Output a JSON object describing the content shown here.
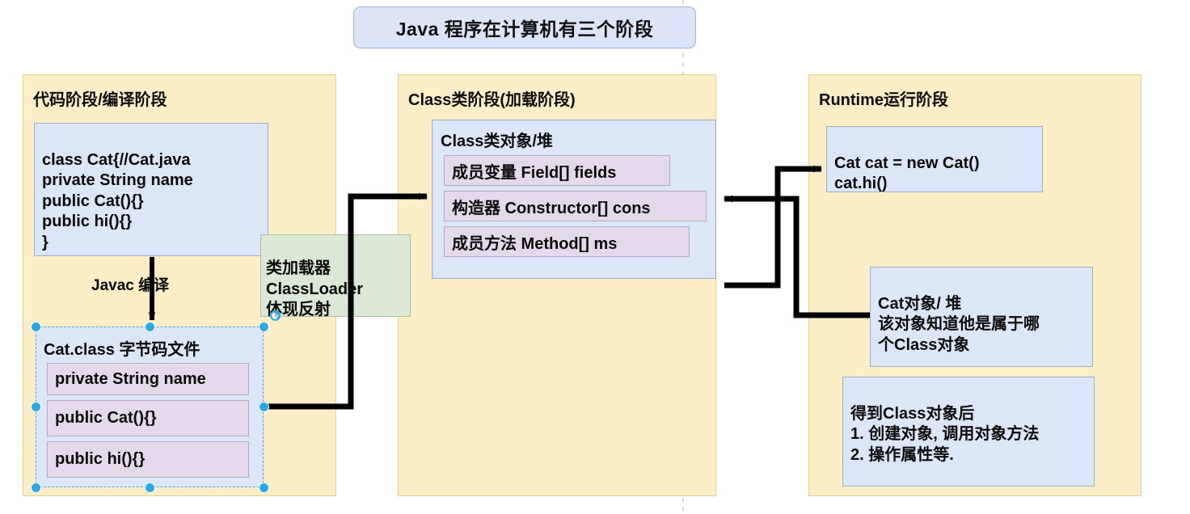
{
  "title_banner": {
    "text": "Java 程序在计算机有三个阶段"
  },
  "stages": [
    {
      "id": "code",
      "title": "代码阶段/编译阶段",
      "source_code": "class Cat{//Cat.java\nprivate String name\npublic Cat(){}\npublic hi(){}\n}",
      "compile_label": "Javac 编译",
      "class_file": {
        "title": "Cat.class 字节码文件",
        "members": [
          "private String name",
          "public Cat(){}",
          "public hi(){}"
        ]
      }
    },
    {
      "id": "class",
      "title": "Class类阶段(加载阶段)",
      "class_object": {
        "title": "Class类对象/堆",
        "members": [
          "成员变量 Field[] fields",
          "构造器 Constructor[] cons",
          "成员方法 Method[] ms"
        ]
      }
    },
    {
      "id": "runtime",
      "title": "Runtime运行阶段",
      "run_code": "Cat cat = new Cat()\ncat.hi()",
      "heap_note": "Cat对象/ 堆\n该对象知道他是属于哪\n个Class对象",
      "usage_note": "得到Class对象后\n1. 创建对象, 调用对象方法\n2. 操作属性等."
    }
  ],
  "classloader_callout": {
    "text": "类加载器\nClassLoader\n体现反射"
  },
  "colors": {
    "panel_fill": "#fdeec7",
    "panel_stroke": "#e3d091",
    "blue_fill": "#dbe6f8",
    "blue_stroke": "#9dadc4",
    "purple_fill": "#e3d9ea",
    "purple_stroke": "#b4a7c2",
    "green_fill": "#dbe8d5",
    "green_stroke": "#a8bfa0",
    "banner_fill": "#dbe5f7",
    "banner_stroke": "#9cb4da",
    "arrow": "#000000",
    "selection": "#2ea8e5"
  }
}
